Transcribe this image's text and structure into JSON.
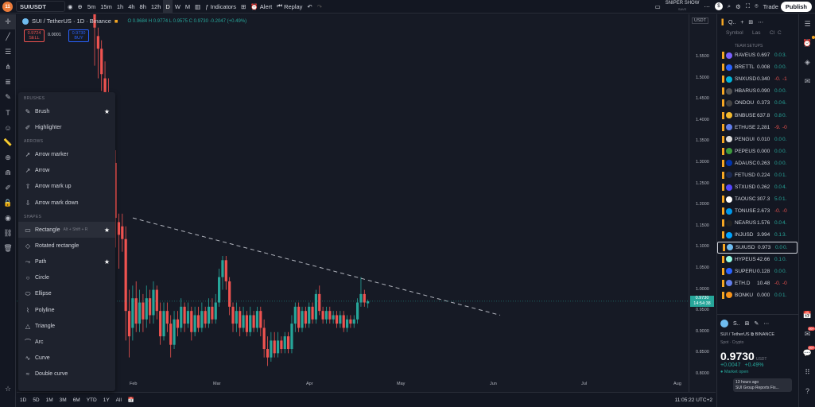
{
  "app": {
    "logo_badge": "11",
    "symbol": "SUIUSDT",
    "timeframes": [
      "5m",
      "15m",
      "1h",
      "4h",
      "8h",
      "12h",
      "D",
      "W",
      "M"
    ],
    "selected_timeframe": "D",
    "indicators_label": "Indicators",
    "alert_label": "Alert",
    "replay_label": "Replay",
    "profile_name": "SNIPER SHOW",
    "profile_sub": "SAVE",
    "trade_label": "Trade",
    "publish_label": "Publish",
    "dollar_badge": "$"
  },
  "chart_header": {
    "title": "SUI / TetherUS · 1D · Binance",
    "ohlc": "O 0.9684 H 0.9774 L 0.9575 C 0.9730 -0.2047 (+0.49%)",
    "sell_price": "0.9724",
    "sell_label": "SELL",
    "spread": "0.0001",
    "buy_price": "0.9730",
    "buy_label": "BUY",
    "currency": "USDT"
  },
  "price_axis": [
    "1.5500",
    "1.5000",
    "1.4500",
    "1.4000",
    "1.3500",
    "1.3000",
    "1.2500",
    "1.2000",
    "1.1500",
    "1.1000",
    "1.0500",
    "1.0000",
    "0.9500",
    "0.9000",
    "0.8500",
    "0.8000"
  ],
  "current_price": {
    "price": "0.9730",
    "countdown": "14:54:38"
  },
  "date_axis": [
    "Feb",
    "Mar",
    "Apr",
    "May",
    "Jun",
    "Jul",
    "Aug"
  ],
  "bottom": {
    "ranges": [
      "1D",
      "5D",
      "1M",
      "3M",
      "6M",
      "YTD",
      "1Y",
      "All"
    ],
    "clock": "11:05:22 UTC+2"
  },
  "draw_menu": {
    "sections": [
      {
        "title": "BRUSHES",
        "items": [
          {
            "label": "Brush",
            "star": true
          },
          {
            "label": "Highlighter",
            "star": false
          }
        ]
      },
      {
        "title": "ARROWS",
        "items": [
          {
            "label": "Arrow marker",
            "star": false
          },
          {
            "label": "Arrow",
            "star": false
          },
          {
            "label": "Arrow mark up",
            "star": false
          },
          {
            "label": "Arrow mark down",
            "star": false
          }
        ]
      },
      {
        "title": "SHAPES",
        "items": [
          {
            "label": "Rectangle",
            "star": true,
            "hotkey": "Alt + Shift + R"
          },
          {
            "label": "Rotated rectangle",
            "star": false
          },
          {
            "label": "Path",
            "star": true
          },
          {
            "label": "Circle",
            "star": false
          },
          {
            "label": "Ellipse",
            "star": false
          },
          {
            "label": "Polyline",
            "star": false
          },
          {
            "label": "Triangle",
            "star": false
          },
          {
            "label": "Arc",
            "star": false
          },
          {
            "label": "Curve",
            "star": false
          },
          {
            "label": "Double curve",
            "star": false
          }
        ]
      }
    ]
  },
  "watchlist": {
    "title": "Q..",
    "columns": [
      "Symbol",
      "Las",
      "Cl",
      "C"
    ],
    "section": "TEAM SETUPS",
    "rows": [
      {
        "sym": "RAVEUS",
        "last": "0.697",
        "chg": "0.0",
        "pct": "3.",
        "dir": "green",
        "color": "#7b61ff"
      },
      {
        "sym": "BRETTL",
        "last": "0.008",
        "chg": "0.0",
        "pct": "0.",
        "dir": "green",
        "color": "#2962ff"
      },
      {
        "sym": "SNXUSD",
        "last": "0.340",
        "chg": "-0.",
        "pct": "-1",
        "dir": "red",
        "color": "#00b4d8"
      },
      {
        "sym": "HBARUS",
        "last": "0.090",
        "chg": "0.0",
        "pct": "0.",
        "dir": "green",
        "color": "#555"
      },
      {
        "sym": "ONDOU",
        "last": "0.373",
        "chg": "0.0",
        "pct": "6.",
        "dir": "green",
        "color": "#444"
      },
      {
        "sym": "BNBUSE",
        "last": "637.8",
        "chg": "0.8",
        "pct": "0.",
        "dir": "green",
        "color": "#f3ba2f"
      },
      {
        "sym": "ETHUSE",
        "last": "2,281",
        "chg": "-9.",
        "pct": "-0",
        "dir": "red",
        "color": "#627eea"
      },
      {
        "sym": "PENGUI",
        "last": "0.010",
        "chg": "0.0",
        "pct": "0.",
        "dir": "green",
        "color": "#ddd"
      },
      {
        "sym": "PEPEUS",
        "last": "0.000",
        "chg": "0.0",
        "pct": "0.",
        "dir": "green",
        "color": "#3d9b3d"
      },
      {
        "sym": "ADAUSC",
        "last": "0.263",
        "chg": "0.0",
        "pct": "0.",
        "dir": "green",
        "color": "#0033ad"
      },
      {
        "sym": "FETUSD",
        "last": "0.224",
        "chg": "0.0",
        "pct": "1.",
        "dir": "green",
        "color": "#1d2b53"
      },
      {
        "sym": "STXUSD",
        "last": "0.262",
        "chg": "0.0",
        "pct": "4.",
        "dir": "green",
        "color": "#5546ff"
      },
      {
        "sym": "TAOUSC",
        "last": "307.3",
        "chg": "5.0",
        "pct": "1.",
        "dir": "green",
        "color": "#fff"
      },
      {
        "sym": "TONUSE",
        "last": "2.673",
        "chg": "-0.",
        "pct": "-0",
        "dir": "red",
        "color": "#0098ea"
      },
      {
        "sym": "NEARUS",
        "last": "1.576",
        "chg": "0.0",
        "pct": "4.",
        "dir": "green",
        "color": "#222"
      },
      {
        "sym": "INJUSD",
        "last": "3.994",
        "chg": "0.1",
        "pct": "3.",
        "dir": "green",
        "color": "#00a3ff"
      },
      {
        "sym": "SUIUSD",
        "last": "0.973",
        "chg": "0.0",
        "pct": "0.",
        "dir": "green",
        "color": "#6fbcf0",
        "active": true
      },
      {
        "sym": "HYPEUS",
        "last": "42.66",
        "chg": "0.1",
        "pct": "0.",
        "dir": "green",
        "color": "#97fce4"
      },
      {
        "sym": "SUPERU",
        "last": "0.128",
        "chg": "0.0",
        "pct": "0.",
        "dir": "green",
        "color": "#2962ff"
      },
      {
        "sym": "ETH.D",
        "last": "10.48",
        "chg": "-0.",
        "pct": "-0",
        "dir": "red",
        "color": "#627eea"
      },
      {
        "sym": "BONKU",
        "last": "0.000",
        "chg": "0.0",
        "pct": "1.",
        "dir": "green",
        "color": "#f7931a"
      }
    ]
  },
  "detail": {
    "short": "S..",
    "name": "SUI / TetherUS",
    "exchange": "BINANCE",
    "category": "Spot · Crypto",
    "price": "0.9730",
    "currency": "USDT",
    "change": "+0.0047",
    "pct": "+0.49%",
    "status": "Market open",
    "news_time": "13 hours ago",
    "news_text": "SUI Group Reports Fis..."
  },
  "far_right_badges": [
    "99+",
    "99+"
  ],
  "chart_data": {
    "type": "candlestick",
    "x_ticks": [
      "Feb",
      "Mar",
      "Apr",
      "May",
      "Jun",
      "Jul",
      "Aug"
    ],
    "ylim": [
      0.78,
      1.58
    ],
    "y_ticks": [
      1.55,
      1.5,
      1.45,
      1.4,
      1.35,
      1.3,
      1.25,
      1.2,
      1.15,
      1.1,
      1.05,
      1.0,
      0.95,
      0.9,
      0.85,
      0.8
    ],
    "candles": [
      [
        1.66,
        1.62,
        1.67,
        1.53
      ],
      [
        1.6,
        1.57,
        1.62,
        1.5
      ],
      [
        1.57,
        1.51,
        1.59,
        1.47
      ],
      [
        1.5,
        1.46,
        1.54,
        1.43
      ],
      [
        1.46,
        1.42,
        1.5,
        1.38
      ],
      [
        1.4,
        1.3,
        1.43,
        1.25
      ],
      [
        1.3,
        1.17,
        1.33,
        1.1
      ],
      [
        1.16,
        1.13,
        1.18,
        1.05
      ],
      [
        1.15,
        1.12,
        1.18,
        1.09
      ],
      [
        1.12,
        0.95,
        1.15,
        0.88
      ],
      [
        0.95,
        0.89,
        1.0,
        0.84
      ],
      [
        0.91,
        0.98,
        1.01,
        0.88
      ],
      [
        0.98,
        0.92,
        1.02,
        0.9
      ],
      [
        0.92,
        0.97,
        1.0,
        0.9
      ],
      [
        0.97,
        0.93,
        0.99,
        0.9
      ],
      [
        0.93,
        0.98,
        1.01,
        0.91
      ],
      [
        0.98,
        0.94,
        1.0,
        0.92
      ],
      [
        0.94,
        1.0,
        1.02,
        0.92
      ],
      [
        1.0,
        0.95,
        1.01,
        0.93
      ],
      [
        0.95,
        0.89,
        0.97,
        0.87
      ],
      [
        0.89,
        0.95,
        0.97,
        0.88
      ],
      [
        0.95,
        0.92,
        0.97,
        0.9
      ],
      [
        0.92,
        0.87,
        0.94,
        0.84
      ],
      [
        0.87,
        0.93,
        0.95,
        0.86
      ],
      [
        0.93,
        0.91,
        0.95,
        0.89
      ],
      [
        0.91,
        0.96,
        0.98,
        0.9
      ],
      [
        0.96,
        0.92,
        0.97,
        0.9
      ],
      [
        0.92,
        0.95,
        0.97,
        0.91
      ],
      [
        0.95,
        0.9,
        0.96,
        0.88
      ],
      [
        0.9,
        0.94,
        0.96,
        0.89
      ],
      [
        0.94,
        0.91,
        0.96,
        0.9
      ],
      [
        0.91,
        0.95,
        0.97,
        0.9
      ],
      [
        0.95,
        0.92,
        0.96,
        0.91
      ],
      [
        0.92,
        0.96,
        0.98,
        0.91
      ],
      [
        0.96,
        0.93,
        0.98,
        0.92
      ],
      [
        0.93,
        0.97,
        0.99,
        0.92
      ],
      [
        0.97,
        1.03,
        1.05,
        0.96
      ],
      [
        1.03,
        1.07,
        1.08,
        1.0
      ],
      [
        1.07,
        1.02,
        1.08,
        1.0
      ],
      [
        1.02,
        0.96,
        1.03,
        0.94
      ],
      [
        0.96,
        0.92,
        0.97,
        0.9
      ],
      [
        0.92,
        0.95,
        0.97,
        0.9
      ],
      [
        0.95,
        0.91,
        0.96,
        0.89
      ],
      [
        0.91,
        0.94,
        0.96,
        0.9
      ],
      [
        0.94,
        0.9,
        0.95,
        0.89
      ],
      [
        0.9,
        0.94,
        0.96,
        0.89
      ],
      [
        0.94,
        0.91,
        0.95,
        0.9
      ],
      [
        0.91,
        0.95,
        0.96,
        0.9
      ],
      [
        0.95,
        0.91,
        0.96,
        0.89
      ],
      [
        0.91,
        0.86,
        0.93,
        0.84
      ],
      [
        0.86,
        0.84,
        0.89,
        0.82
      ],
      [
        0.84,
        0.88,
        0.9,
        0.83
      ],
      [
        0.88,
        0.85,
        0.9,
        0.84
      ],
      [
        0.85,
        0.88,
        0.9,
        0.84
      ],
      [
        0.88,
        0.86,
        0.89,
        0.85
      ],
      [
        0.86,
        0.89,
        0.9,
        0.85
      ],
      [
        0.89,
        0.86,
        0.9,
        0.85
      ],
      [
        0.86,
        0.92,
        0.94,
        0.85
      ],
      [
        0.92,
        0.96,
        0.97,
        0.9
      ],
      [
        0.96,
        0.91,
        0.97,
        0.9
      ],
      [
        0.91,
        0.95,
        0.96,
        0.9
      ],
      [
        0.95,
        0.92,
        0.96,
        0.91
      ],
      [
        0.92,
        0.96,
        0.97,
        0.91
      ],
      [
        0.96,
        0.93,
        0.97,
        0.92
      ],
      [
        0.93,
        0.99,
        1.0,
        0.92
      ],
      [
        0.99,
        0.95,
        1.01,
        0.94
      ],
      [
        0.95,
        0.93,
        0.96,
        0.92
      ],
      [
        0.93,
        0.95,
        0.96,
        0.92
      ],
      [
        0.95,
        0.93,
        0.96,
        0.92
      ],
      [
        0.93,
        0.94,
        0.95,
        0.92
      ],
      [
        0.94,
        0.92,
        0.95,
        0.91
      ],
      [
        0.92,
        0.94,
        0.95,
        0.91
      ],
      [
        0.94,
        0.91,
        0.95,
        0.9
      ],
      [
        0.91,
        0.93,
        0.94,
        0.9
      ],
      [
        0.93,
        0.92,
        0.94,
        0.91
      ],
      [
        0.92,
        0.93,
        0.94,
        0.91
      ],
      [
        0.93,
        0.97,
        0.98,
        0.92
      ],
      [
        0.97,
        0.99,
        1.03,
        0.96
      ],
      [
        0.99,
        0.97,
        1.0,
        0.96
      ],
      [
        0.968,
        0.973,
        0.977,
        0.957
      ]
    ],
    "trendline": [
      [
        1.17,
        0
      ],
      [
        0.94,
        1
      ]
    ],
    "current_price": 0.973
  }
}
